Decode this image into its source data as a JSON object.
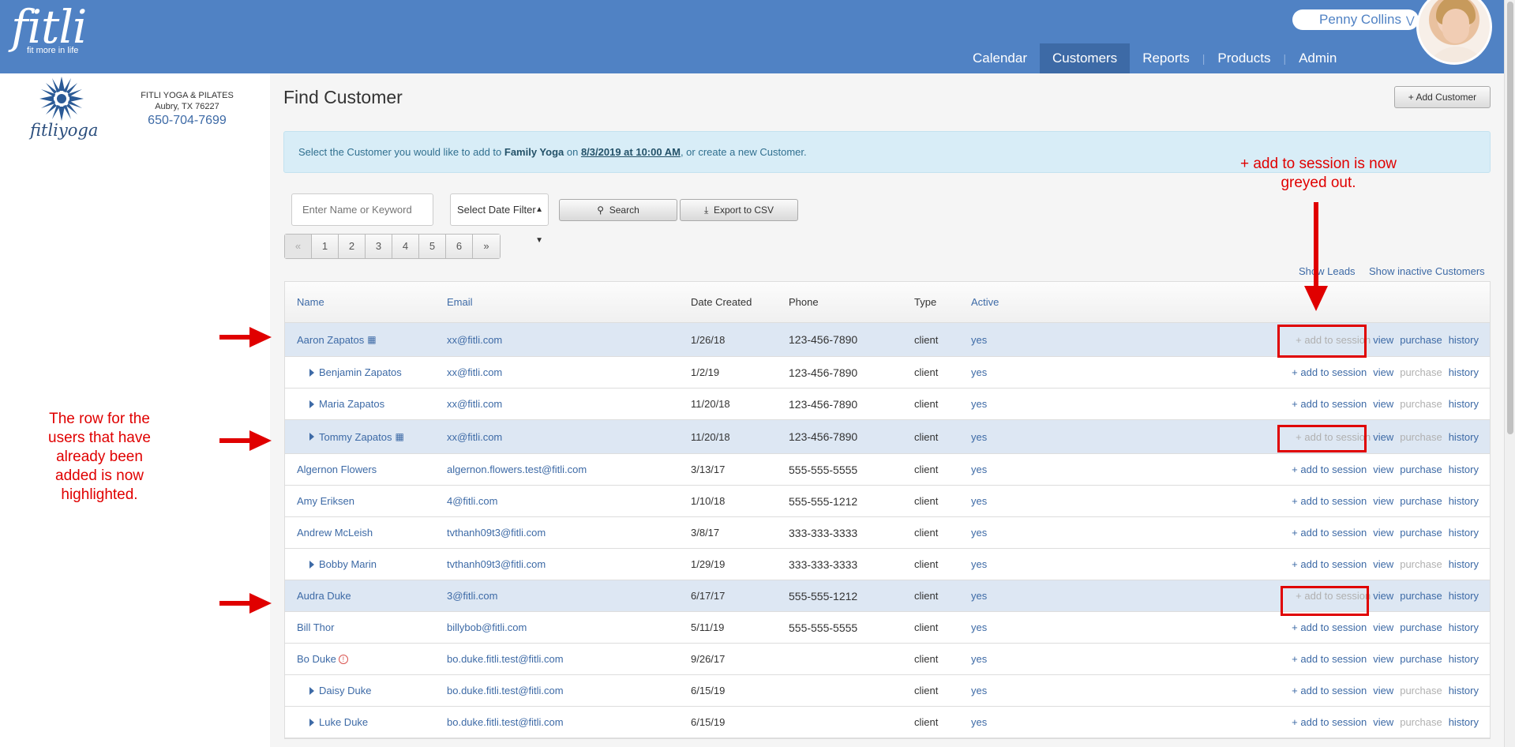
{
  "header": {
    "logo_text": "fitli",
    "logo_tagline": "fit more in life",
    "user_name": "Penny Collins",
    "nav": [
      {
        "label": "Calendar"
      },
      {
        "label": "Customers"
      },
      {
        "label": "Reports"
      },
      {
        "label": "Products"
      },
      {
        "label": "Admin"
      }
    ],
    "active_nav": "Customers"
  },
  "sidebar": {
    "studio_logo_text": "fitliyoga",
    "studio_name": "FITLI YOGA & PILATES",
    "studio_city": "Aubry, TX 76227",
    "studio_phone": "650-704-7699"
  },
  "main": {
    "title": "Find Customer",
    "add_customer_label": "+ Add Customer",
    "banner": {
      "prefix": "Select the Customer you would like to add to ",
      "class_name": "Family Yoga",
      "on": " on ",
      "datetime": "8/3/2019 at 10:00 AM",
      "suffix": ", or create a new Customer."
    },
    "search_placeholder": "Enter Name or Keyword",
    "date_filter": "Select Date Filter",
    "search_label": "Search",
    "export_label": "Export to CSV",
    "pagination": [
      "«",
      "1",
      "2",
      "3",
      "4",
      "5",
      "6",
      "»"
    ],
    "show_leads": "Show Leads",
    "show_inactive": "Show inactive Customers",
    "columns": [
      "Name",
      "Email",
      "Date Created",
      "Phone",
      "Type",
      "Active"
    ],
    "action_labels": {
      "add": "+ add to session",
      "view": "view",
      "purchase": "purchase",
      "history": "history"
    },
    "rows": [
      {
        "name": "Aaron Zapatos",
        "email": "xx@fitli.com",
        "date": "1/26/18",
        "phone": "123-456-7890",
        "type": "client",
        "active": "yes",
        "child": false,
        "highlight": true,
        "icon": "group",
        "add_dim": true,
        "purchase_dim": false
      },
      {
        "name": "Benjamin Zapatos",
        "email": "xx@fitli.com",
        "date": "1/2/19",
        "phone": "123-456-7890",
        "type": "client",
        "active": "yes",
        "child": true,
        "highlight": false,
        "icon": "",
        "add_dim": false,
        "purchase_dim": true
      },
      {
        "name": "Maria Zapatos",
        "email": "xx@fitli.com",
        "date": "11/20/18",
        "phone": "123-456-7890",
        "type": "client",
        "active": "yes",
        "child": true,
        "highlight": false,
        "icon": "",
        "add_dim": false,
        "purchase_dim": true
      },
      {
        "name": "Tommy Zapatos",
        "email": "xx@fitli.com",
        "date": "11/20/18",
        "phone": "123-456-7890",
        "type": "client",
        "active": "yes",
        "child": true,
        "highlight": true,
        "icon": "group",
        "add_dim": true,
        "purchase_dim": true
      },
      {
        "name": "Algernon Flowers",
        "email": "algernon.flowers.test@fitli.com",
        "date": "3/13/17",
        "phone": "555-555-5555",
        "type": "client",
        "active": "yes",
        "child": false,
        "highlight": false,
        "icon": "",
        "add_dim": false,
        "purchase_dim": false
      },
      {
        "name": "Amy Eriksen",
        "email": "4@fitli.com",
        "date": "1/10/18",
        "phone": "555-555-1212",
        "type": "client",
        "active": "yes",
        "child": false,
        "highlight": false,
        "icon": "",
        "add_dim": false,
        "purchase_dim": false
      },
      {
        "name": "Andrew McLeish",
        "email": "tvthanh09t3@fitli.com",
        "date": "3/8/17",
        "phone": "333-333-3333",
        "type": "client",
        "active": "yes",
        "child": false,
        "highlight": false,
        "icon": "",
        "add_dim": false,
        "purchase_dim": false
      },
      {
        "name": "Bobby Marin",
        "email": "tvthanh09t3@fitli.com",
        "date": "1/29/19",
        "phone": "333-333-3333",
        "type": "client",
        "active": "yes",
        "child": true,
        "highlight": false,
        "icon": "",
        "add_dim": false,
        "purchase_dim": true
      },
      {
        "name": "Audra Duke",
        "email": "3@fitli.com",
        "date": "6/17/17",
        "phone": "555-555-1212",
        "type": "client",
        "active": "yes",
        "child": false,
        "highlight": true,
        "icon": "",
        "add_dim": true,
        "purchase_dim": false
      },
      {
        "name": "Bill Thor",
        "email": "billybob@fitli.com",
        "date": "5/11/19",
        "phone": "555-555-5555",
        "type": "client",
        "active": "yes",
        "child": false,
        "highlight": false,
        "icon": "",
        "add_dim": false,
        "purchase_dim": false
      },
      {
        "name": "Bo Duke",
        "email": "bo.duke.fitli.test@fitli.com",
        "date": "9/26/17",
        "phone": "",
        "type": "client",
        "active": "yes",
        "child": false,
        "highlight": false,
        "icon": "alert",
        "add_dim": false,
        "purchase_dim": false
      },
      {
        "name": "Daisy Duke",
        "email": "bo.duke.fitli.test@fitli.com",
        "date": "6/15/19",
        "phone": "",
        "type": "client",
        "active": "yes",
        "child": true,
        "highlight": false,
        "icon": "",
        "add_dim": false,
        "purchase_dim": true
      },
      {
        "name": "Luke Duke",
        "email": "bo.duke.fitli.test@fitli.com",
        "date": "6/15/19",
        "phone": "",
        "type": "client",
        "active": "yes",
        "child": true,
        "highlight": false,
        "icon": "",
        "add_dim": false,
        "purchase_dim": true
      }
    ]
  },
  "annotations": {
    "top_note": "+ add to session is now greyed out.",
    "left_note": "The row for the users that have already been added is now highlighted.",
    "color": "#e00000"
  },
  "colors": {
    "header": "#5082c4",
    "nav_active": "#3d6aa6",
    "link": "#3d6aa6",
    "row_highlight": "#dde7f3",
    "banner": "#d8edf7"
  }
}
